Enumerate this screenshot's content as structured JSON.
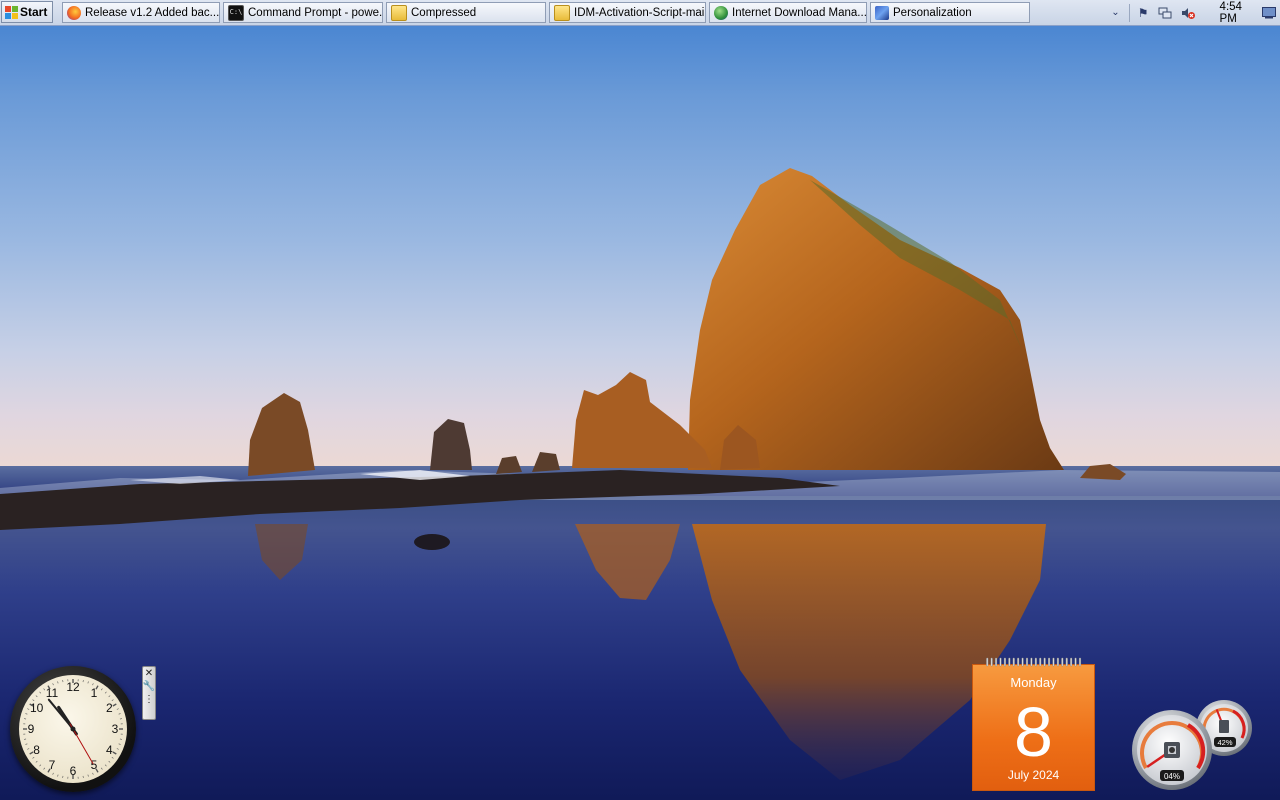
{
  "taskbar": {
    "start_label": "Start",
    "tasks": [
      {
        "label": "Release v1.2 Added bac...",
        "icon": "firefox-icon"
      },
      {
        "label": "Command Prompt - powe...",
        "icon": "cmd-icon"
      },
      {
        "label": "Compressed",
        "icon": "folder-icon"
      },
      {
        "label": "IDM-Activation-Script-main",
        "icon": "folder-icon"
      },
      {
        "label": "Internet Download Mana...",
        "icon": "idm-icon"
      },
      {
        "label": "Personalization",
        "icon": "personalization-icon"
      }
    ],
    "tray": {
      "icons": [
        "chevron-down-icon",
        "flag-icon",
        "network-icon",
        "volume-muted-icon"
      ],
      "time": "4:54 PM"
    }
  },
  "gadgets": {
    "clock": {
      "numbers": [
        "12",
        "1",
        "2",
        "3",
        "4",
        "5",
        "6",
        "7",
        "8",
        "9",
        "10",
        "11"
      ],
      "time": {
        "hour": 10,
        "minute": 53,
        "second": 25
      }
    },
    "calendar": {
      "day_name": "Monday",
      "day": "8",
      "month_year": "July 2024"
    },
    "cpu_meter": {
      "cpu_label": "04%",
      "memory_label": "42%",
      "cpu_percent": 4,
      "memory_percent": 42
    }
  },
  "colors": {
    "calendar_orange": "#ee6f17",
    "taskbar": "#d4dcea",
    "rock": "#b5651d"
  }
}
